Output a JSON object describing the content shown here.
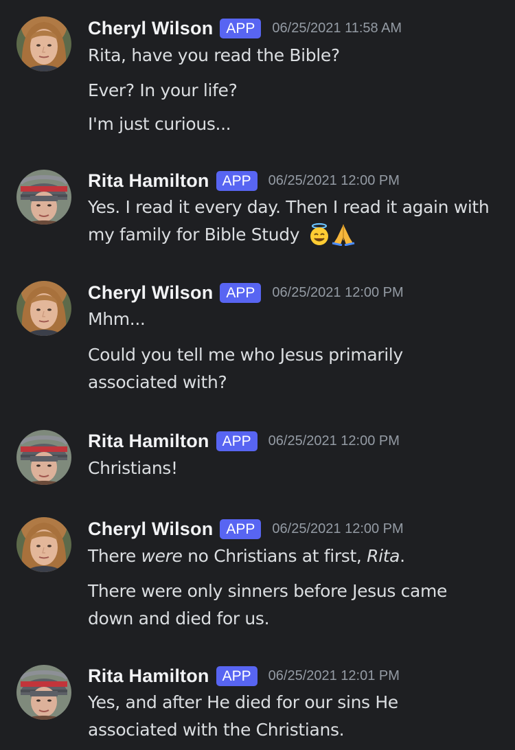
{
  "messages": [
    {
      "author": "Cheryl Wilson",
      "badge": "APP",
      "timestamp": "06/25/2021 11:58 AM",
      "avatar": "cheryl-avatar",
      "lines": [
        "Rita, have you read the Bible?",
        "Ever? In your life?",
        "I'm just curious..."
      ]
    },
    {
      "author": "Rita Hamilton",
      "badge": "APP",
      "timestamp": "06/25/2021 12:00 PM",
      "avatar": "rita-avatar",
      "lines": [
        "Yes. I read it every day. Then I read it again with",
        "my family for Bible Study"
      ],
      "emojis": [
        "smiling-face-with-halo",
        "folded-hands"
      ]
    },
    {
      "author": "Cheryl Wilson",
      "badge": "APP",
      "timestamp": "06/25/2021 12:00 PM",
      "avatar": "cheryl-avatar",
      "lines": [
        "Mhm...",
        "Could you tell me who Jesus primarily",
        "associated with?"
      ]
    },
    {
      "author": "Rita Hamilton",
      "badge": "APP",
      "timestamp": "06/25/2021 12:00 PM",
      "avatar": "rita-avatar",
      "lines": [
        "Christians!"
      ]
    },
    {
      "author": "Cheryl Wilson",
      "badge": "APP",
      "timestamp": "06/25/2021 12:00 PM",
      "avatar": "cheryl-avatar",
      "line0": {
        "pre": "There ",
        "em1": "were",
        "mid": " no Christians at first, ",
        "em2": "Rita",
        "post": "."
      },
      "lines": [
        "There were only sinners before Jesus came",
        "down and died for us."
      ]
    },
    {
      "author": "Rita Hamilton",
      "badge": "APP",
      "timestamp": "06/25/2021 12:01 PM",
      "avatar": "rita-avatar",
      "lines": [
        "Yes, and after He died for our sins He",
        "associated with the Christians."
      ]
    }
  ],
  "colors": {
    "background": "#1e1f22",
    "badge": "#5865f2",
    "author": "#f2f3f5",
    "text": "#dbdee1",
    "timestamp": "#949ba4"
  }
}
